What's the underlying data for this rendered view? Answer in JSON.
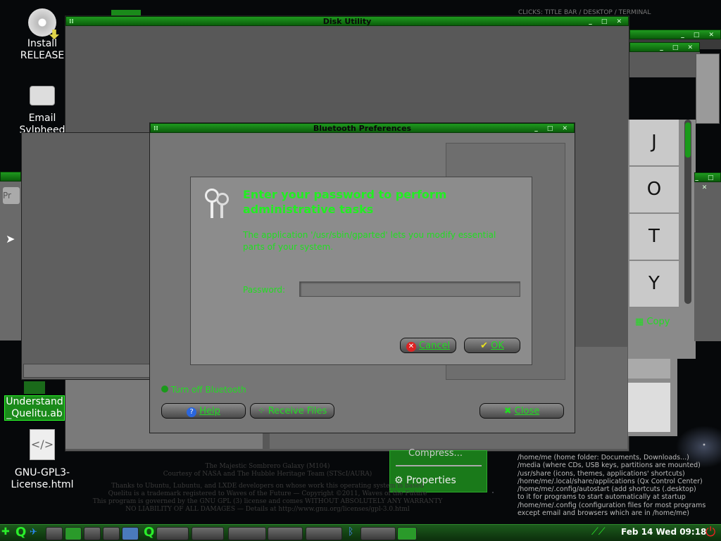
{
  "desktop": {
    "icons": [
      {
        "label": "Install\nRELEASE",
        "line1": "Install",
        "line2": "RELEASE"
      },
      {
        "label": "Email Sylpheed",
        "line1": "Email",
        "line2": "Sylpheed"
      },
      {
        "label": "Understand _Quelitu.ab",
        "line1": "Understand",
        "line2": "_Quelitu.ab"
      },
      {
        "label": "GNU-GPL3-License.html",
        "line1": "GNU-GPL3-",
        "line2": "License.html"
      }
    ],
    "hint_top": "CLICKS: TITLE BAR / DESKTOP / TERMINAL",
    "credits": [
      "The Majestic Sombrero Galaxy (M104)",
      "Courtesy of NASA and The Hubble Heritage Team (STScI/AURA)",
      "Thanks to Ubuntu, Lubuntu, and LXDE developers on whose work this operating system is based",
      "Quelitu is a trademark registered to Waves of the Future — Copyright ©2011, Waves of the Future",
      "This program is governed by the GNU GPL (3) license and comes WITHOUT ABSOLUTELY ANY WARRANTY",
      "NO LIABILITY OF ALL DAMAGES — Details at http://www.gnu.org/licenses/gpl-3.0.html"
    ],
    "info_lines": [
      "/home/me (home folder: Documents, Downloads...)",
      "/media (where CDs, USB keys, partitions are mounted)",
      "/usr/share (icons, themes, applications' shortcuts)",
      "/home/me/.local/share/applications (Qx Control Center)",
      "/home/me/.config/autostart (add shortcuts (.desktop)",
      "to it for programs to start automatically at startup",
      "/home/me/.config (configuration files for most programs",
      "except email and browsers which are in /home/me)"
    ],
    "context_menu": {
      "compress": "Compress...",
      "properties": "Properties"
    }
  },
  "disk_utility": {
    "title": "Disk Utility"
  },
  "bluetooth": {
    "title": "Bluetooth Preferences",
    "status": "Turn off Bluetooth",
    "help": "Help",
    "receive": "Receive Files",
    "close": "Close"
  },
  "keyboard": {
    "keys": [
      "J",
      "O",
      "T",
      "Y"
    ],
    "copy": "Copy"
  },
  "auth_dialog": {
    "heading": "Enter your password to perform administrative tasks",
    "message": "The application '/usr/sbin/gparted' lets you modify essential parts of your system.",
    "password_label": "Password:",
    "password_value": "",
    "cancel": "Cancel",
    "ok": "OK"
  },
  "taskbar": {
    "clock": "Feb 14 Wed 09:18"
  },
  "colors": {
    "accent": "#22dd22",
    "titlebar": "#1f9a1f",
    "dialog_bg": "#8c8c8c"
  }
}
